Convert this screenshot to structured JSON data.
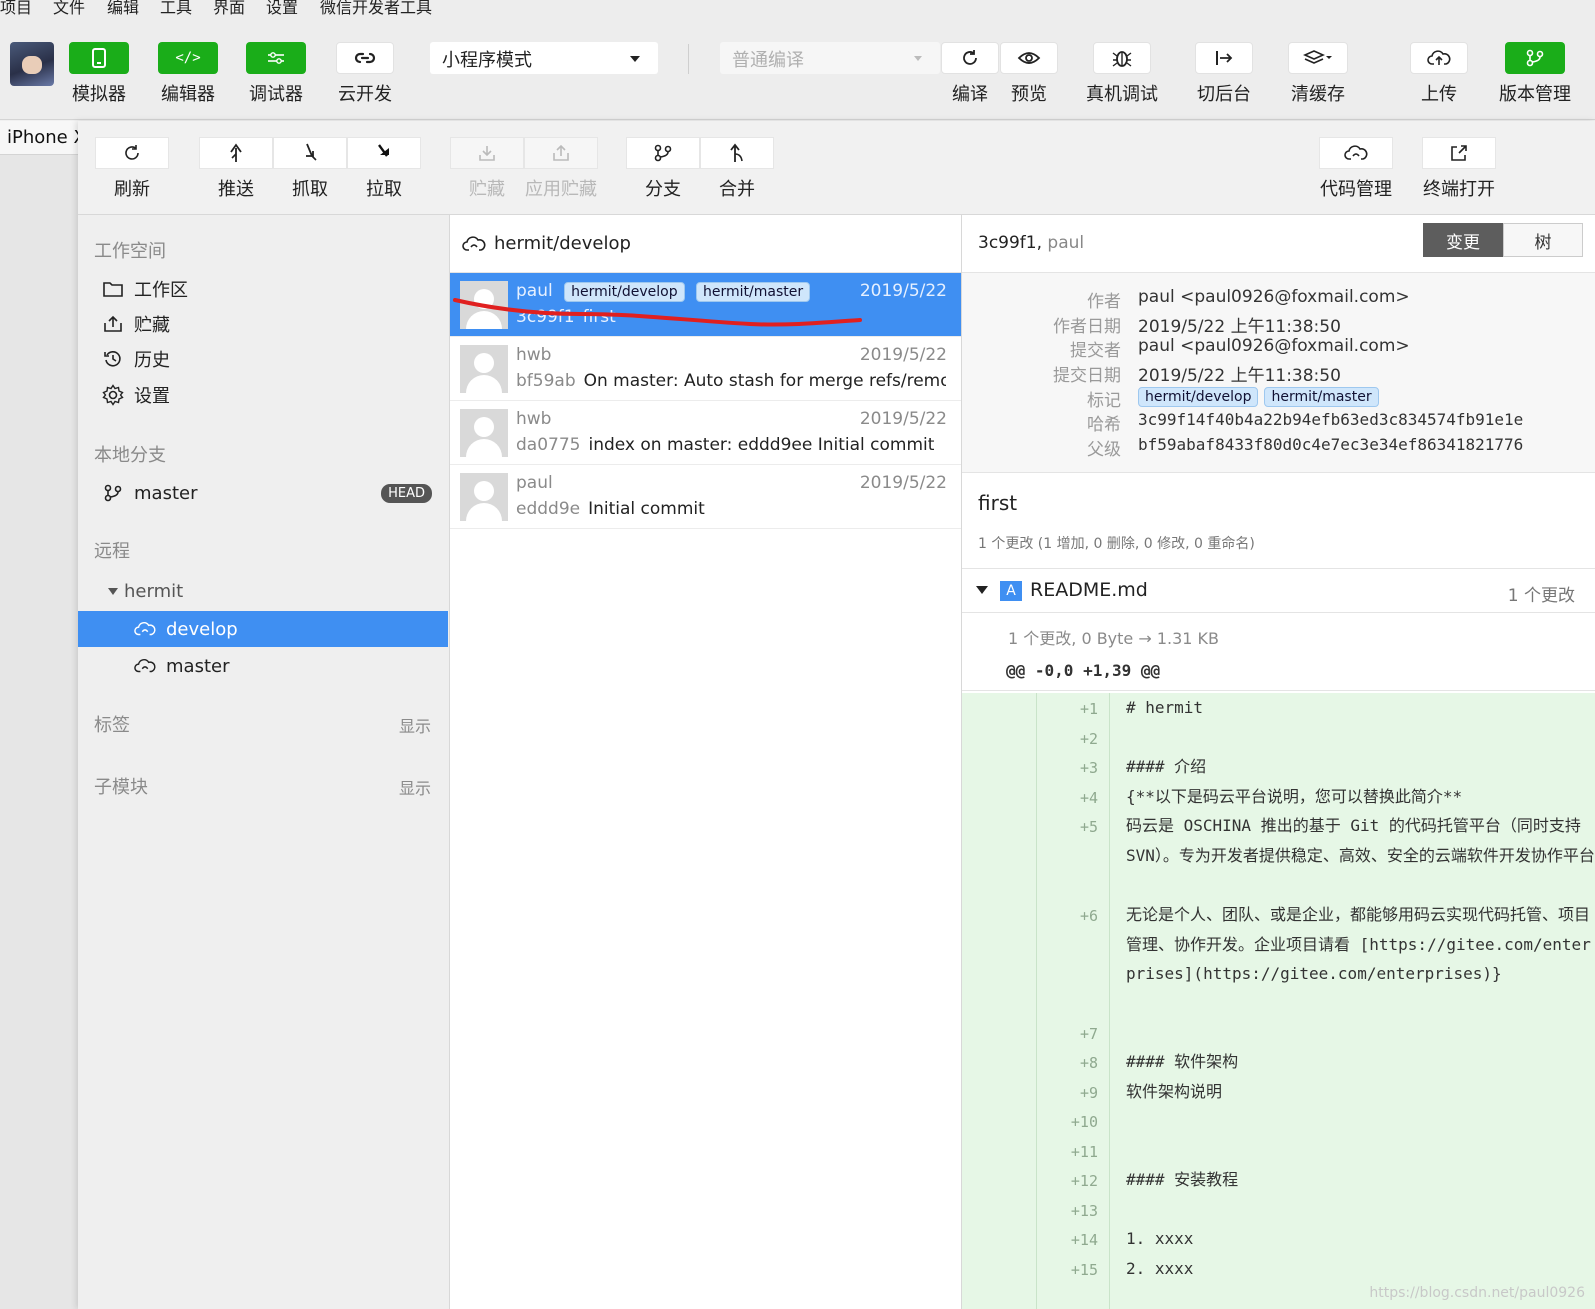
{
  "menubar": {
    "items": [
      "项目",
      "文件",
      "编辑",
      "工具",
      "界面",
      "设置",
      "微信开发者工具"
    ]
  },
  "toolbar": {
    "simulator": "模拟器",
    "editor": "编辑器",
    "debugger": "调试器",
    "cloud": "云开发",
    "mode_value": "小程序模式",
    "compile_placeholder": "普通编译",
    "compile": "编译",
    "preview": "预览",
    "real_debug": "真机调试",
    "background": "切后台",
    "clear_cache": "清缓存",
    "upload": "上传",
    "version_mgmt": "版本管理",
    "accent": "#1aad19"
  },
  "device": {
    "tab": "iPhone X"
  },
  "vc_toolbar": {
    "refresh": "刷新",
    "push": "推送",
    "fetch": "抓取",
    "pull": "拉取",
    "stash": "贮藏",
    "apply_stash": "应用贮藏",
    "branch": "分支",
    "merge": "合并",
    "code_mgmt": "代码管理",
    "terminal": "终端打开"
  },
  "sidebar": {
    "workspace_title": "工作空间",
    "workspace_items": [
      "工作区",
      "贮藏",
      "历史",
      "设置"
    ],
    "local_title": "本地分支",
    "local_branch": "master",
    "head_badge": "HEAD",
    "remote_title": "远程",
    "remote_name": "hermit",
    "remote_branches": [
      "develop",
      "master"
    ],
    "tags_title": "标签",
    "tags_show": "显示",
    "submodule_title": "子模块",
    "submodule_show": "显示",
    "active_color": "#3f8ff2"
  },
  "commits": {
    "header": "hermit/develop",
    "list": [
      {
        "author": "paul",
        "tags": [
          "hermit/develop",
          "hermit/master"
        ],
        "date": "2019/5/22",
        "hash": "3c99f1",
        "message": "first"
      },
      {
        "author": "hwb",
        "tags": [],
        "date": "2019/5/22",
        "hash": "bf59ab",
        "message": "On master: Auto stash for merge refs/remote..."
      },
      {
        "author": "hwb",
        "tags": [],
        "date": "2019/5/22",
        "hash": "da0775",
        "message": "index on master: eddd9ee Initial commit"
      },
      {
        "author": "paul",
        "tags": [],
        "date": "2019/5/22",
        "hash": "eddd9e",
        "message": "Initial commit"
      }
    ]
  },
  "detail": {
    "hash_short": "3c99f1,",
    "author_short": "paul",
    "seg_changes": "变更",
    "seg_tree": "树",
    "meta": {
      "author_k": "作者",
      "author_v": "paul <paul0926@foxmail.com>",
      "adate_k": "作者日期",
      "adate_v": "2019/5/22 上午11:38:50",
      "committer_k": "提交者",
      "committer_v": "paul <paul0926@foxmail.com>",
      "cdate_k": "提交日期",
      "cdate_v": "2019/5/22 上午11:38:50",
      "tags_k": "标记",
      "tags": [
        "hermit/develop",
        "hermit/master"
      ],
      "hash_k": "哈希",
      "hash_v": "3c99f14f40b4a22b94efb63ed3c834574fb91e1e",
      "parent_k": "父级",
      "parent_v": "bf59abaf8433f80d0c4e7ec3e34ef86341821776"
    },
    "title": "first",
    "stat": "1 个更改 (1 增加, 0 删除, 0 修改, 0 重命名)",
    "file": {
      "status": "A",
      "name": "README.md",
      "count": "1 个更改",
      "size": "1 个更改, 0 Byte → 1.31 KB",
      "hunk": "@@ -0,0 +1,39 @@"
    },
    "diff_lines": [
      {
        "n": "+1",
        "text": "# hermit"
      },
      {
        "n": "+2",
        "text": ""
      },
      {
        "n": "+3",
        "text": "#### 介绍"
      },
      {
        "n": "+4",
        "text": "{**以下是码云平台说明，您可以替换此简介**"
      },
      {
        "n": "+5",
        "text": "码云是 OSCHINA 推出的基于 Git 的代码托管平台（同时支持 SVN）。专为开发者提供稳定、高效、安全的云端软件开发协作平台"
      },
      {
        "n": "+6",
        "text": "无论是个人、团队、或是企业，都能够用码云实现代码托管、项目管理、协作开发。企业项目请看 [https://gitee.com/enterprises](https://gitee.com/enterprises)}"
      },
      {
        "n": "+7",
        "text": ""
      },
      {
        "n": "+8",
        "text": "#### 软件架构"
      },
      {
        "n": "+9",
        "text": "软件架构说明"
      },
      {
        "n": "+10",
        "text": ""
      },
      {
        "n": "+11",
        "text": ""
      },
      {
        "n": "+12",
        "text": "#### 安装教程"
      },
      {
        "n": "+13",
        "text": ""
      },
      {
        "n": "+14",
        "text": "1. xxxx"
      },
      {
        "n": "+15",
        "text": "2. xxxx"
      }
    ]
  },
  "watermark": "https://blog.csdn.net/paul0926"
}
